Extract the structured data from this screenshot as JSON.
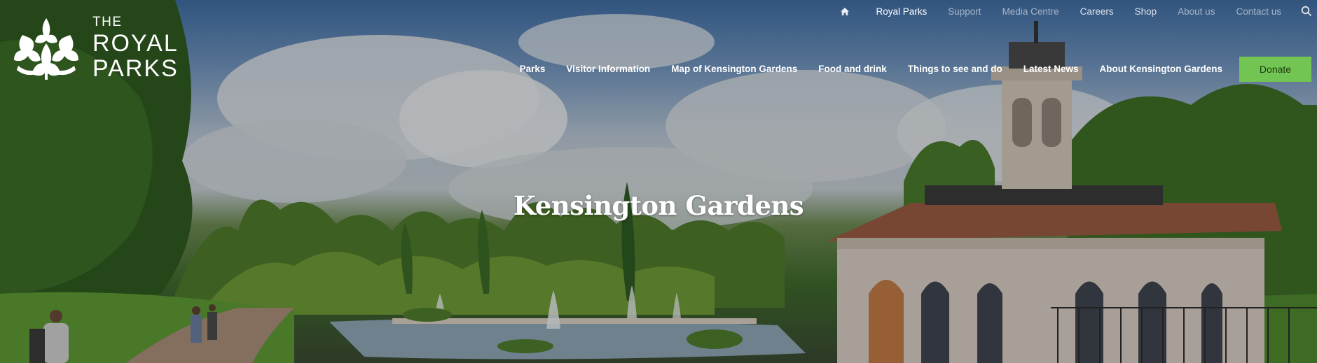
{
  "site": {
    "logo_text": [
      "THE",
      "ROYAL",
      "PARKS"
    ],
    "brand_accent": "#72c553"
  },
  "utility_nav": {
    "home_icon": "home-icon",
    "items": [
      "Royal Parks",
      "Support",
      "Media Centre",
      "Careers",
      "Shop",
      "About us",
      "Contact us"
    ],
    "search_icon": "search-icon"
  },
  "main_nav": {
    "items": [
      "Parks",
      "Visitor Information",
      "Map of Kensington Gardens",
      "Food and drink",
      "Things to see and do",
      "Latest News",
      "About Kensington Gardens"
    ],
    "donate_label": "Donate"
  },
  "hero": {
    "title": "Kensington Gardens"
  }
}
